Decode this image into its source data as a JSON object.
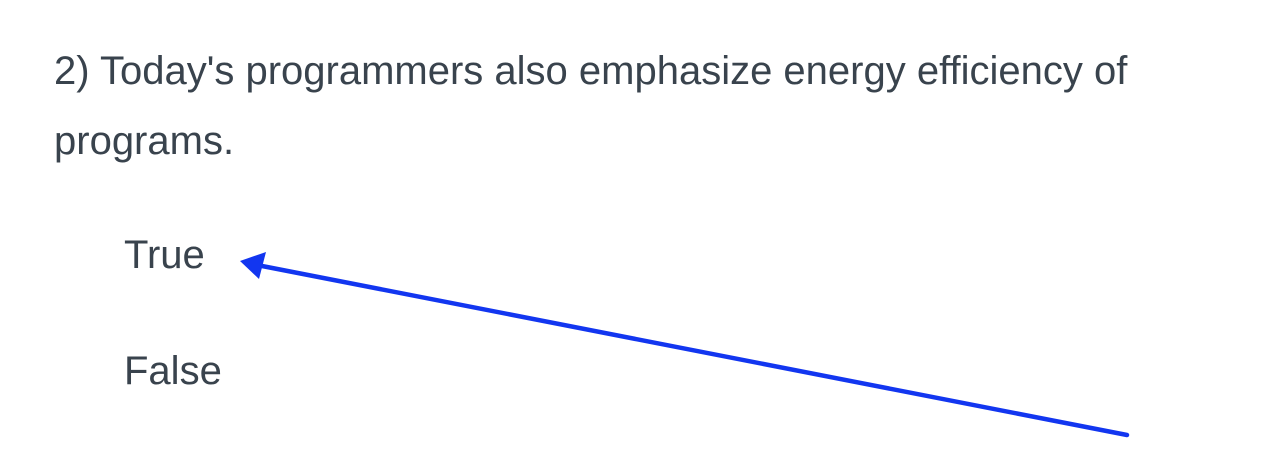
{
  "question": {
    "text": "2) Today's programmers also emphasize energy efficiency of programs."
  },
  "options": [
    {
      "label": "True"
    },
    {
      "label": "False"
    }
  ],
  "annotation": {
    "type": "arrow",
    "color": "#1236f0",
    "points_to": "True"
  }
}
